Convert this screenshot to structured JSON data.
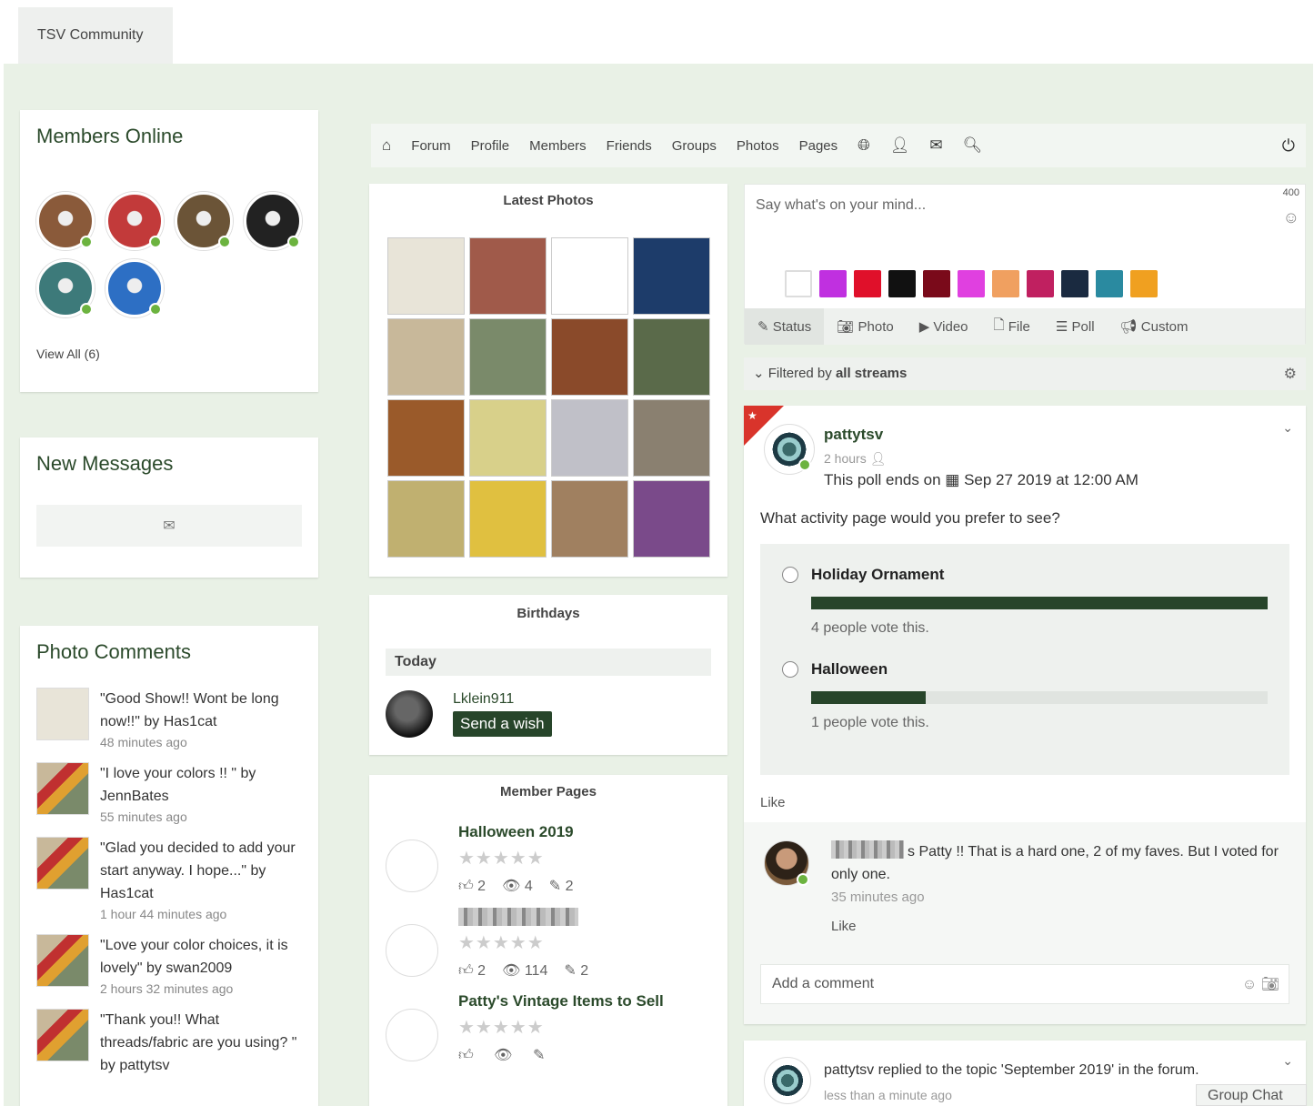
{
  "top_tab": "TSV Community",
  "members_online": {
    "title": "Members Online",
    "view_all": "View All (6)",
    "avatars": [
      {
        "bg": "#8a5a3a"
      },
      {
        "bg": "#c23a3a"
      },
      {
        "bg": "#6b5437"
      },
      {
        "bg": "#222222"
      },
      {
        "bg": "#3d7a7a"
      },
      {
        "bg": "#2d6fc4"
      }
    ]
  },
  "new_messages": {
    "title": "New Messages",
    "icon": "envelope-icon"
  },
  "photo_comments": {
    "title": "Photo Comments",
    "items": [
      {
        "text": "\"Good Show!! Wont be long now!!\" by Has1cat",
        "time": "48 minutes ago"
      },
      {
        "text": "\"I love your colors !! \" by JennBates",
        "time": "55 minutes ago"
      },
      {
        "text": "\"Glad you decided to add your start anyway. I hope...\" by Has1cat",
        "time": "1 hour 44 minutes ago"
      },
      {
        "text": "\"Love your color choices, it is lovely\" by swan2009",
        "time": "2 hours 32 minutes ago"
      },
      {
        "text": "\"Thank you!! What threads/fabric are you using? \" by pattytsv",
        "time": ""
      }
    ]
  },
  "nav": {
    "items": [
      "Forum",
      "Profile",
      "Members",
      "Friends",
      "Groups",
      "Photos",
      "Pages"
    ],
    "icons": [
      "home-icon",
      "globe-icon",
      "user-add-icon",
      "envelope-icon",
      "search-icon",
      "power-icon"
    ]
  },
  "latest_photos": {
    "title": "Latest Photos",
    "colors": [
      "#e8e4d8",
      "#a05a4a",
      "#ffffff",
      "#1d3c6a",
      "#c8b89a",
      "#7a8a6a",
      "#8a4a2a",
      "#5a6a4a",
      "#9a5a2a",
      "#d8d08a",
      "#c0c0c8",
      "#8a8070",
      "#c0b070",
      "#e0c040",
      "#a08060",
      "#7a4a8a"
    ]
  },
  "birthdays": {
    "title": "Birthdays",
    "today": "Today",
    "name": "Lklein911",
    "button": "Send a wish"
  },
  "member_pages": {
    "title": "Member Pages",
    "stars": "★★★★★",
    "items": [
      {
        "name": "Halloween 2019",
        "blurred": false,
        "likes": "2",
        "views": "4",
        "edits": "2"
      },
      {
        "name": "",
        "blurred": true,
        "likes": "2",
        "views": "114",
        "edits": "2"
      },
      {
        "name": "Patty's Vintage Items to Sell",
        "blurred": false,
        "likes": "",
        "views": "",
        "edits": ""
      }
    ]
  },
  "composer": {
    "placeholder": "Say what's on your mind...",
    "char_count": "400",
    "swatches": [
      "#ffffff",
      "#c030e0",
      "#e0102a",
      "#111111",
      "#7a0a1a",
      "#e040e0",
      "#f0a060",
      "#c02060",
      "#1a2a40",
      "#2a8aa0",
      "#f0a020"
    ],
    "tabs": [
      "Status",
      "Photo",
      "Video",
      "File",
      "Poll",
      "Custom"
    ]
  },
  "filter": {
    "prefix": "Filtered by",
    "value": "all streams"
  },
  "post": {
    "author": "pattytsv",
    "time": "2 hours",
    "poll_ends_prefix": "This poll ends on",
    "poll_ends_date": "Sep 27 2019 at 12:00 AM",
    "question": "What activity page would you prefer to see?",
    "options": [
      {
        "label": "Holiday Ornament",
        "votes_text": "4 people vote this.",
        "share": 1.0
      },
      {
        "label": "Halloween",
        "votes_text": "1 people vote this.",
        "share": 0.25
      }
    ],
    "like": "Like",
    "comment": {
      "text": "s Patty !! That is a hard one, 2 of my faves. But I voted for only one.",
      "time": "35 minutes ago",
      "like": "Like"
    },
    "add_comment": "Add a comment"
  },
  "post2": {
    "text": "pattytsv replied to the topic 'September 2019' in the forum.",
    "time": "less than a minute ago"
  },
  "group_chat": "Group Chat"
}
